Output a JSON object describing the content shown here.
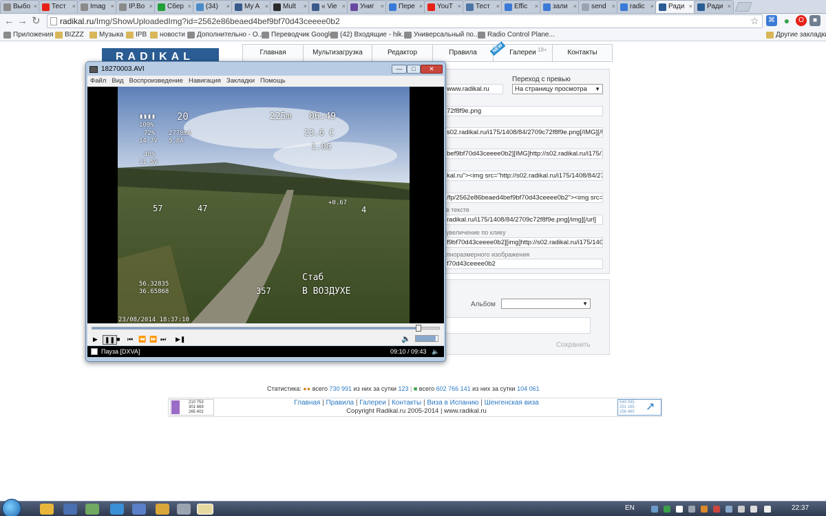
{
  "browser": {
    "tabs": [
      {
        "label": "Выбо",
        "icon": "wand-icon",
        "color": "#8a8a8a"
      },
      {
        "label": "Тест",
        "icon": "youtube-icon",
        "color": "#e62117"
      },
      {
        "label": "Imag",
        "icon": "wand-icon",
        "color": "#8a8a8a"
      },
      {
        "label": "IP.Bo",
        "icon": "wand-icon",
        "color": "#8a8a8a"
      },
      {
        "label": "Сбер",
        "icon": "green-circle-icon",
        "color": "#21a038"
      },
      {
        "label": "(34)",
        "icon": "chat-icon",
        "color": "#4a8bc9"
      },
      {
        "label": "My A",
        "icon": "hang-icon",
        "color": "#3a5a8a"
      },
      {
        "label": "Mult",
        "icon": "crown-icon",
        "color": "#2b2b2b"
      },
      {
        "label": "« Vie",
        "icon": "hang-icon",
        "color": "#3a5a8a"
      },
      {
        "label": "Униг",
        "icon": "mail-icon",
        "color": "#6a4aa0"
      },
      {
        "label": "Пере",
        "icon": "translate-icon",
        "color": "#3a7ad6"
      },
      {
        "label": "YouT",
        "icon": "youtube-icon",
        "color": "#e62117"
      },
      {
        "label": "Тест",
        "icon": "vk-icon",
        "color": "#4c75a3"
      },
      {
        "label": "Effic",
        "icon": "google-icon",
        "color": "#3a7ad6"
      },
      {
        "label": "зали",
        "icon": "google-icon",
        "color": "#3a7ad6"
      },
      {
        "label": "send",
        "icon": "loading-icon",
        "color": "#9aa3b0"
      },
      {
        "label": "radic",
        "icon": "google-icon",
        "color": "#3a7ad6"
      },
      {
        "label": "Ради",
        "icon": "radikal-icon",
        "color": "#2b5d94",
        "active": true
      },
      {
        "label": "Ради",
        "icon": "radikal-icon",
        "color": "#2b5d94"
      }
    ],
    "url_host": "radikal.ru",
    "url_path": "/Img/ShowUploadedImg?id=2562e86beaed4bef9bf70d43ceeee0b2",
    "bookmarks": [
      {
        "label": "Приложения",
        "icon": "apps-icon"
      },
      {
        "label": "BIZZZ",
        "icon": "folder-icon"
      },
      {
        "label": "Музыка",
        "icon": "folder-icon"
      },
      {
        "label": "IPB",
        "icon": "folder-icon"
      },
      {
        "label": "новости",
        "icon": "folder-icon"
      },
      {
        "label": "Дополнительно - О...",
        "icon": "wand-icon"
      },
      {
        "label": "Переводчик Google",
        "icon": "translate-icon"
      },
      {
        "label": "(42) Входящие - hik...",
        "icon": "mail-icon"
      },
      {
        "label": "Универсальный по...",
        "icon": "mail-icon"
      },
      {
        "label": "Radio Control Plane...",
        "icon": "crown-icon"
      }
    ],
    "other_bookmarks": "Другие закладки"
  },
  "site": {
    "logo": "RADIKAL",
    "nav": [
      "Главная",
      "Мультизагрузка",
      "Редактор",
      "Правила",
      "Галереи",
      "Контакты"
    ],
    "new_badge": "NEW",
    "adult_badge": "18+",
    "preview_label": "Переход с превью",
    "preview_select": "На страницу просмотра",
    "site_field": "www.radikal.ru",
    "fields": [
      "72f8f9e.png",
      "s02.radikal.ru/i175/1408/84/2709c72f8f9e.png[/IMG][/URL",
      "bef9bf70d43ceeee0b2][IMG]http://s02.radikal.ru/i175/14",
      "kal.ru\"><img src=\"http://s02.radikal.ru/i175/1408/84/27(",
      "/fp/2562e86beaed4bef9bf70d43ceeee0b2\"><img src=\"h",
      "radikal.ru/i175/1408/84/2709c72f8f9e.png[/img][/url]",
      "f9bf70d43ceeee0b2][img]http://s02.radikal.ru/i175/1408",
      "f70d43ceeee0b2"
    ],
    "field_labels": [
      "в тексте",
      "увеличение по клику",
      "лноразмерного изображения"
    ],
    "album_label": "Альбом",
    "save_label": "Сохранить",
    "stats": {
      "label": "Статистика:",
      "total1_label": "всего",
      "total1": "730 991",
      "daily1_label": "из них за сутки",
      "daily1": "123",
      "total2_label": "всего",
      "total2": "602 766 141",
      "daily2_label": "из них за сутки",
      "daily2": "104 061"
    },
    "footer_links": [
      "Главная",
      "Правила",
      "Галереи",
      "Контакты",
      "Виза в Испанию",
      "Шенгенская виза"
    ],
    "copyright": "Copyright Radikal.ru 2005-2014 | www.radikal.ru",
    "counter_left": [
      "210 753",
      "301 669",
      "265 402"
    ],
    "counter_right": [
      "549 595",
      "251 165",
      "258 485"
    ]
  },
  "player": {
    "title": "18270003.AVI",
    "menu": [
      "Файл",
      "Вид",
      "Воспроизведение",
      "Навигация",
      "Закладки",
      "Помощь"
    ],
    "status": "Пауза [DXVA]",
    "time": "09:10 / 09:43",
    "progress": 0.94,
    "volume": 0.9,
    "osd": {
      "signal": "20",
      "battery_pct": "100%",
      "b1": "72%",
      "v1": "14.7V",
      "mah": "2778mA",
      "amp": "5.8A",
      "b2": "40%",
      "v2": "11.5V",
      "distance": "225m",
      "clock": "06:49",
      "temp": "23.6 C",
      "g": "1.0G",
      "speed": "57",
      "alt": "47",
      "climb": "+0.67",
      "vs": "4",
      "lat": "56.32835",
      "lon": "36.65868",
      "heading": "357",
      "mode": "Стаб",
      "status": "В ВОЗДУХЕ",
      "datetime": "23/08/2014 18:37:10"
    }
  },
  "taskbar": {
    "lang": "EN",
    "clock": "22:37"
  }
}
